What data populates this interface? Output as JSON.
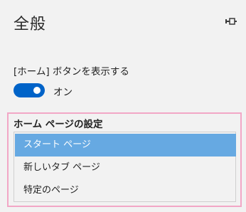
{
  "panel": {
    "title": "全般",
    "pin_icon": "pin-icon"
  },
  "home_button": {
    "label": "[ホーム] ボタンを表示する",
    "toggle_state": "オン",
    "toggle_on": true,
    "accent_color": "#0063c8"
  },
  "homepage": {
    "title": "ホーム ページの設定",
    "options": [
      {
        "label": "スタート ページ",
        "selected": true
      },
      {
        "label": "新しいタブ ページ",
        "selected": false
      },
      {
        "label": "特定のページ",
        "selected": false
      }
    ],
    "selected_color": "#66a9e2",
    "highlight_color": "#f2a7c6"
  }
}
